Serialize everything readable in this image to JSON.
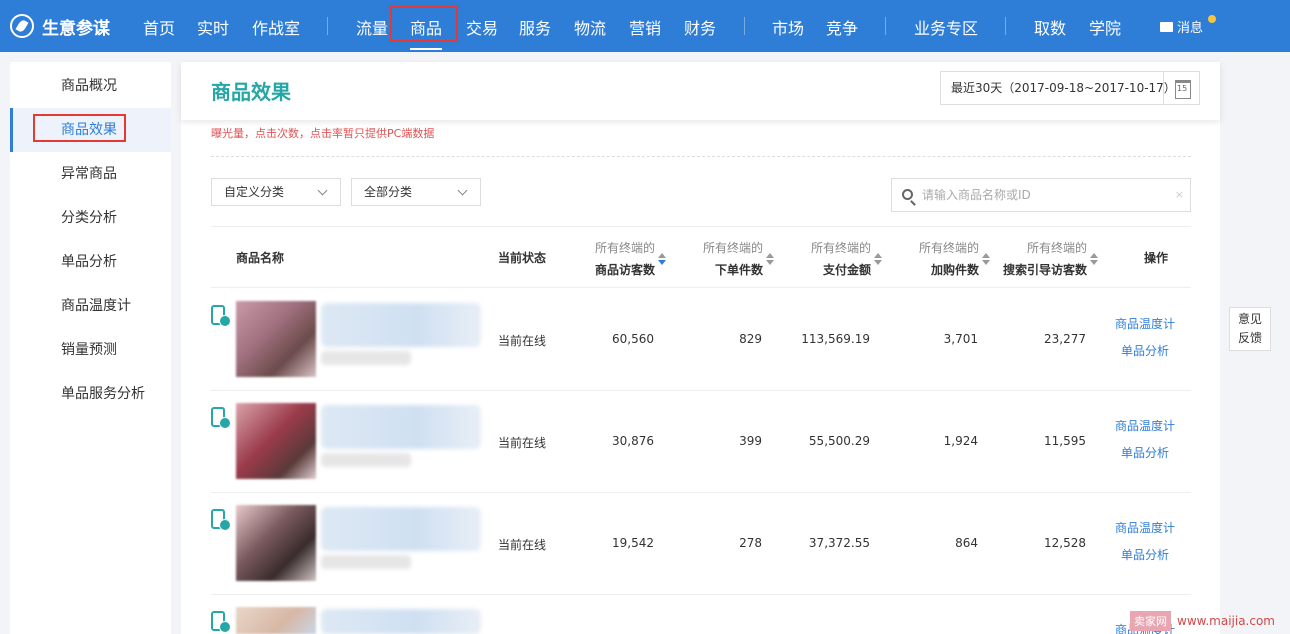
{
  "app": {
    "name": "生意参谋"
  },
  "nav": {
    "items": [
      "首页",
      "实时",
      "作战室",
      "流量",
      "商品",
      "交易",
      "服务",
      "物流",
      "营销",
      "财务",
      "市场",
      "竞争",
      "业务专区",
      "取数",
      "学院"
    ],
    "active": "商品",
    "message": "消息"
  },
  "sidebar": {
    "items": [
      "商品概况",
      "商品效果",
      "异常商品",
      "分类分析",
      "单品分析",
      "商品温度计",
      "销量预测",
      "单品服务分析"
    ],
    "active": "商品效果"
  },
  "main": {
    "title": "商品效果",
    "date_range": "最近30天（2017-09-18~2017-10-17）",
    "calendar_day": "15",
    "notice": "曝光量，点击次数，点击率暂只提供PC端数据",
    "filters": {
      "custom_category": "自定义分类",
      "all_category": "全部分类"
    },
    "search": {
      "placeholder": "请输入商品名称或ID",
      "clear": "×"
    }
  },
  "table": {
    "headers": {
      "name": "商品名称",
      "status": "当前状态",
      "prefix": "所有终端的",
      "visitors": "商品访客数",
      "orders": "下单件数",
      "amount": "支付金额",
      "cart": "加购件数",
      "search_visitors": "搜索引导访客数",
      "action": "操作"
    },
    "rows": [
      {
        "status": "当前在线",
        "visitors": "60,560",
        "orders": "829",
        "amount": "113,569.19",
        "cart": "3,701",
        "search_visitors": "23,277"
      },
      {
        "status": "当前在线",
        "visitors": "30,876",
        "orders": "399",
        "amount": "55,500.29",
        "cart": "1,924",
        "search_visitors": "11,595"
      },
      {
        "status": "当前在线",
        "visitors": "19,542",
        "orders": "278",
        "amount": "37,372.55",
        "cart": "864",
        "search_visitors": "12,528"
      }
    ],
    "actions": {
      "temp": "商品温度计",
      "single": "单品分析"
    }
  },
  "feedback": {
    "line1": "意见",
    "line2": "反馈"
  },
  "watermark": {
    "badge": "卖家网",
    "url": "www.maijia.com"
  },
  "colors": {
    "primary": "#2e7ed8",
    "teal": "#26a6a6",
    "highlight": "#e53935",
    "notice": "#e05252"
  }
}
